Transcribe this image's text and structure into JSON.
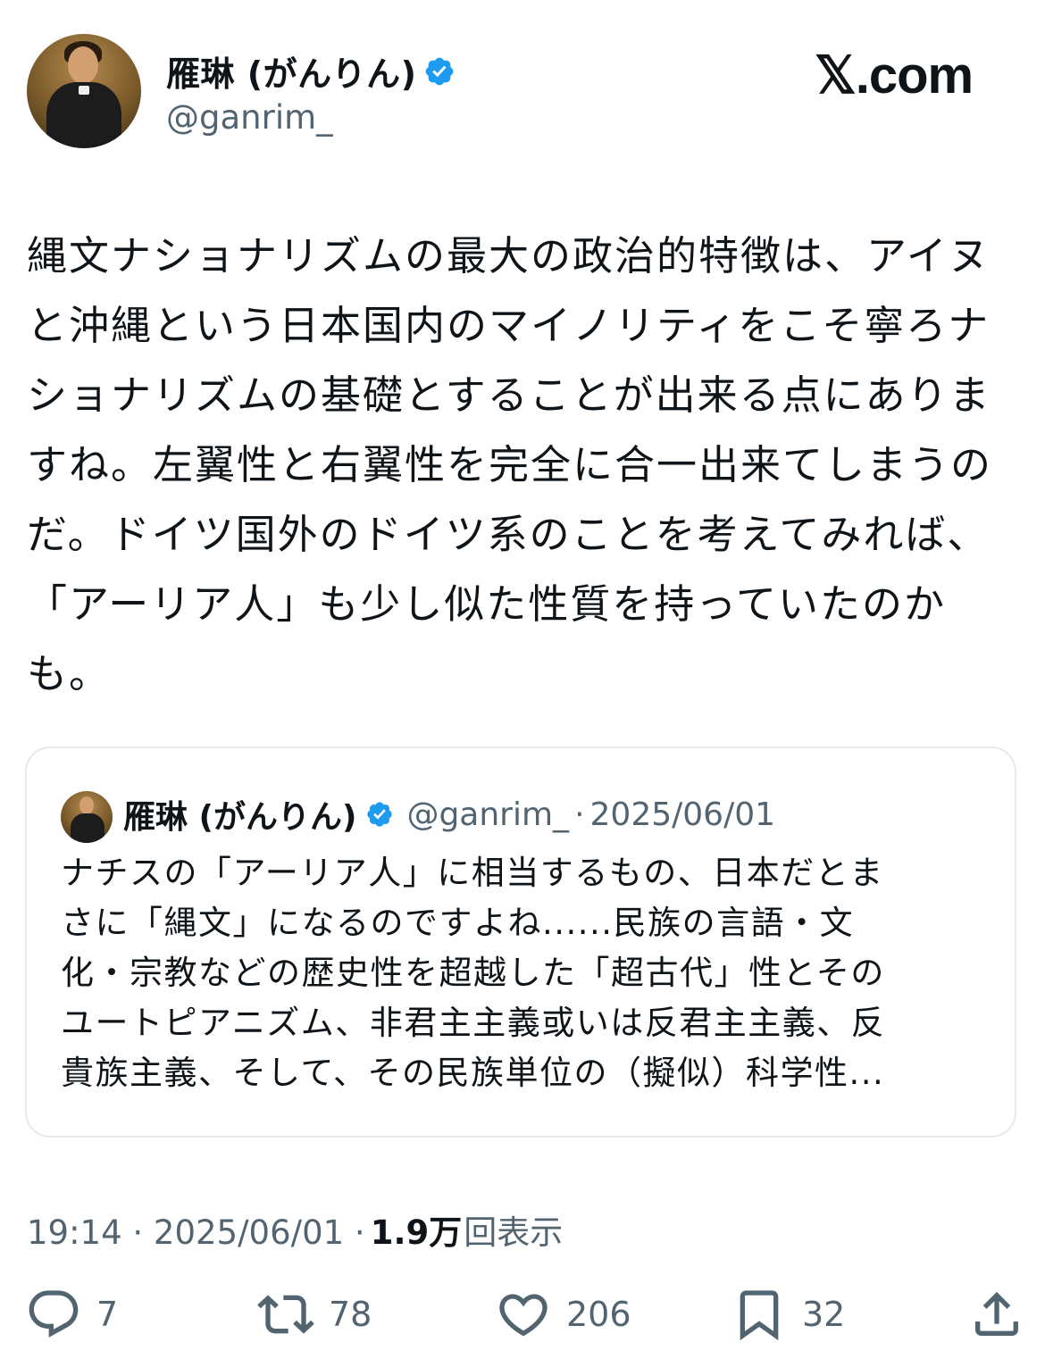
{
  "author": {
    "name": "雁琳 (がんりん)",
    "handle": "@ganrim_",
    "verified_color": "#1d9bf0"
  },
  "brand": "𝕏.com",
  "post": {
    "text": "縄文ナショナリズムの最大の政治的特徴は、アイヌ\nと沖縄という日本国内のマイノリティをこそ寧ろナ\nショナリズムの基礎とすることが出来る点にありま\nすね。左翼性と右翼性を完全に合一出来てしまうの\nだ。ドイツ国外のドイツ系のことを考えてみれば、\n「アーリア人」も少し似た性質を持っていたのか\nも。"
  },
  "quote": {
    "name": "雁琳 (がんりん)",
    "handle": "@ganrim_",
    "separator": "·",
    "date": "2025/06/01",
    "text": "ナチスの「アーリア人」に相当するもの、日本だとま\nさに「縄文」になるのですよね......民族の言語・文\n化・宗教などの歴史性を超越した「超古代」性とその\nユートピアニズム、非君主主義或いは反君主主義、反\n貴族主義、そして、その民族単位の（擬似）科学性..."
  },
  "meta": {
    "time_date": "19:14 · 2025/06/01 · ",
    "views": "1.9万",
    "views_label": "回表示"
  },
  "actions": {
    "replies": "7",
    "reposts": "78",
    "likes": "206",
    "bookmarks": "32"
  }
}
